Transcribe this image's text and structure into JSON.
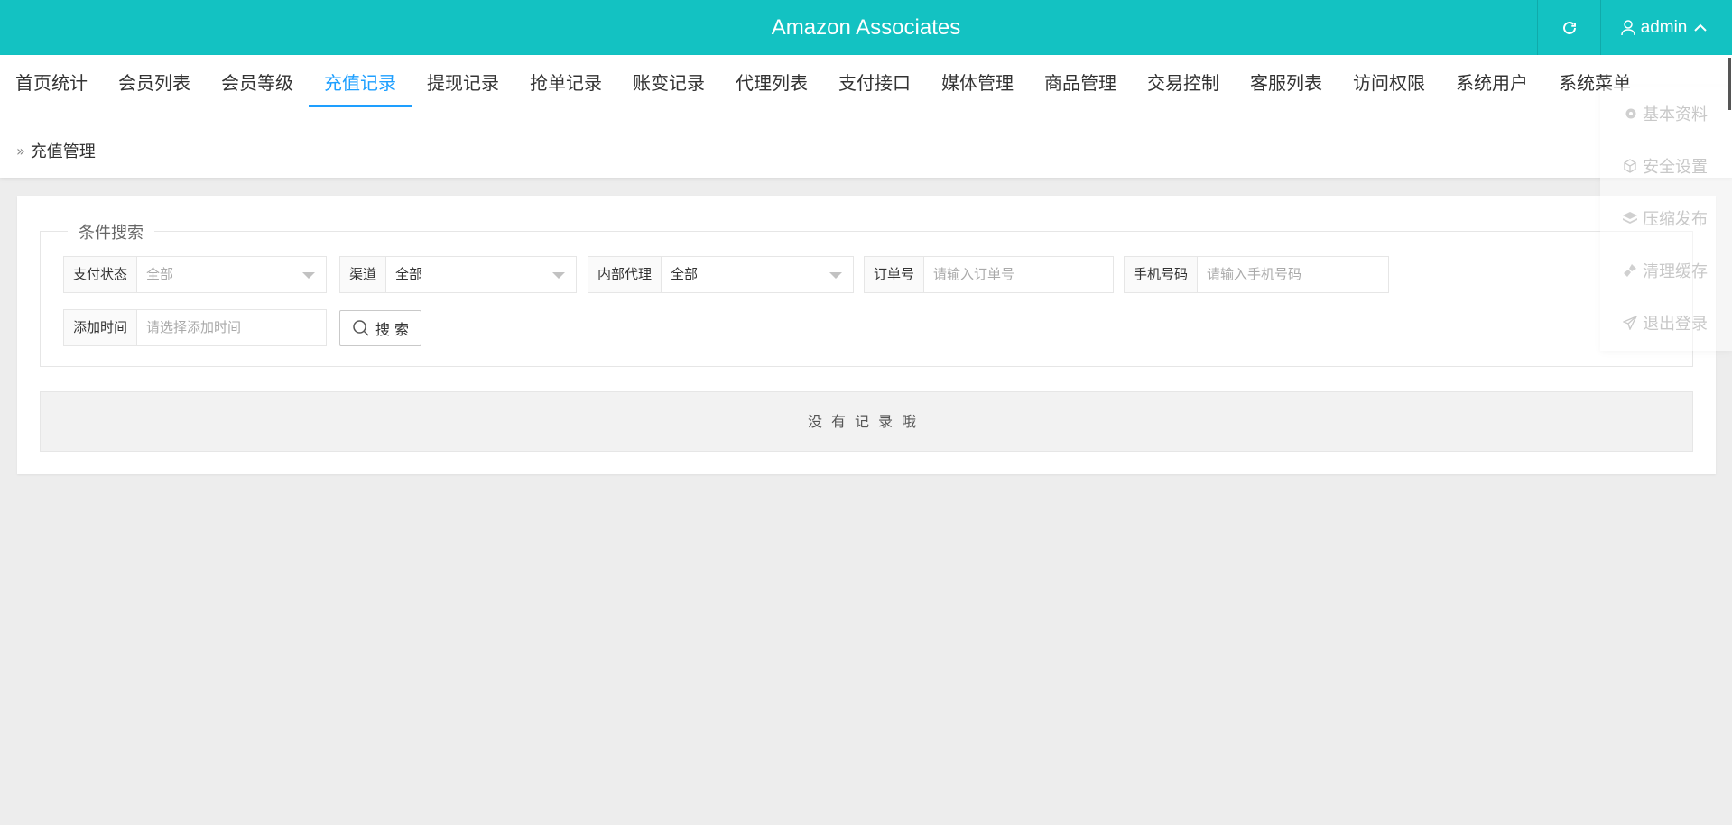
{
  "header": {
    "title": "Amazon Associates",
    "refresh_icon": "refresh-icon",
    "user_name": "admin"
  },
  "nav": {
    "items": [
      "首页统计",
      "会员列表",
      "会员等级",
      "充值记录",
      "提现记录",
      "抢单记录",
      "账变记录",
      "代理列表",
      "支付接口",
      "媒体管理",
      "商品管理",
      "交易控制",
      "客服列表",
      "访问权限",
      "系统用户",
      "系统菜单"
    ],
    "active": "充值记录"
  },
  "breadcrumb": "充值管理",
  "user_menu": {
    "items": [
      {
        "label": "基本资料",
        "icon": "gear-icon"
      },
      {
        "label": "安全设置",
        "icon": "cube-icon"
      },
      {
        "label": "压缩发布",
        "icon": "layers-icon"
      },
      {
        "label": "清理缓存",
        "icon": "brush-icon"
      },
      {
        "label": "退出登录",
        "icon": "send-icon"
      }
    ]
  },
  "search": {
    "legend": "条件搜索",
    "pay_status": {
      "label": "支付状态",
      "value": "全部"
    },
    "channel": {
      "label": "渠道",
      "value": "全部"
    },
    "agent": {
      "label": "内部代理",
      "value": "全部"
    },
    "order_no": {
      "label": "订单号",
      "placeholder": "请输入订单号"
    },
    "phone": {
      "label": "手机号码",
      "placeholder": "请输入手机号码"
    },
    "add_time": {
      "label": "添加时间",
      "placeholder": "请选择添加时间"
    },
    "submit_label": "搜 索"
  },
  "empty_text": "没有记录哦"
}
